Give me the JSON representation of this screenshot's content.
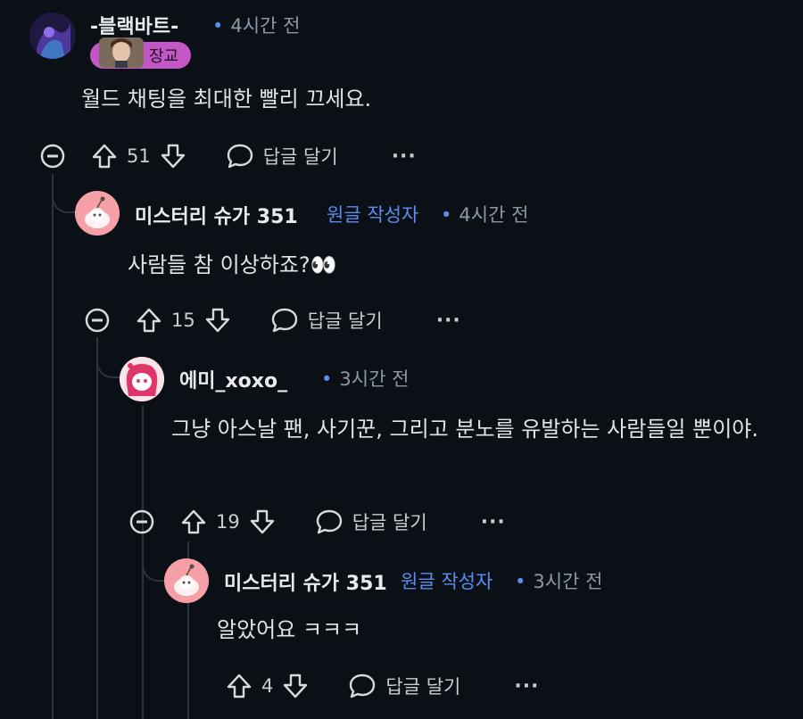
{
  "comments": [
    {
      "username": "-블랙바트-",
      "time": "4시간 전",
      "flair": "장교",
      "body": "월드 채팅을 최대한 빨리 끄세요.",
      "votes": "51",
      "reply_label": "답글 달기"
    },
    {
      "username": "미스터리 슈가 351",
      "op_tag": "원글 작성자",
      "time": "4시간 전",
      "body": "사람들 참 이상하죠?👀",
      "votes": "15",
      "reply_label": "답글 달기"
    },
    {
      "username": "에미_xoxo_",
      "time": "3시간 전",
      "body": "그냥 아스날 팬, 사기꾼, 그리고 분노를 유발하는 사람들일 뿐이야.",
      "votes": "19",
      "reply_label": "답글 달기"
    },
    {
      "username": "미스터리 슈가 351",
      "op_tag": "원글 작성자",
      "time": "3시간 전",
      "body": "알았어요 ㅋㅋㅋ",
      "votes": "4",
      "reply_label": "답글 달기"
    }
  ],
  "more_label": "···",
  "colors": {
    "background": "#0b1016",
    "op_tag": "#5b8def",
    "flair": "#c457c6",
    "snoo_bg": "#f4a0a6"
  },
  "icons": [
    "collapse-icon",
    "upvote-icon",
    "downvote-icon",
    "reply-bubble-icon",
    "more-icon",
    "snoo-avatar-icon"
  ]
}
